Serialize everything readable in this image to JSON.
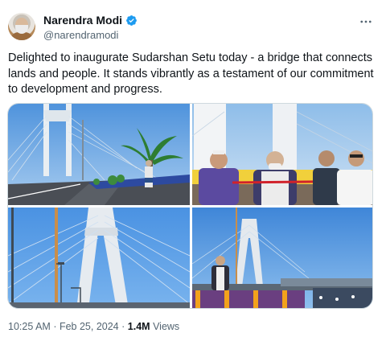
{
  "author": {
    "display_name": "Narendra Modi",
    "handle": "@narendramodi",
    "verified_icon": "verified-badge-icon",
    "badge_color": "#1d9bf0"
  },
  "more_icon": "more-horizontal-icon",
  "tweet": {
    "text": "Delighted to inaugurate Sudarshan Setu today - a bridge that connects lands and people. It stands vibrantly as a testament of our commitment to development and progress."
  },
  "media": {
    "photos": [
      {
        "subject": "bridge-roadway-with-palm"
      },
      {
        "subject": "ribbon-cutting"
      },
      {
        "subject": "pylon-cables"
      },
      {
        "subject": "inauguration-stage"
      }
    ]
  },
  "meta": {
    "time": "10:25 AM",
    "sep": "·",
    "date": "Feb 25, 2024",
    "views_count": "1.4M",
    "views_label": "Views"
  },
  "colors": {
    "text": "#0f1419",
    "secondary": "#536471",
    "sky": "#5a9be0"
  }
}
